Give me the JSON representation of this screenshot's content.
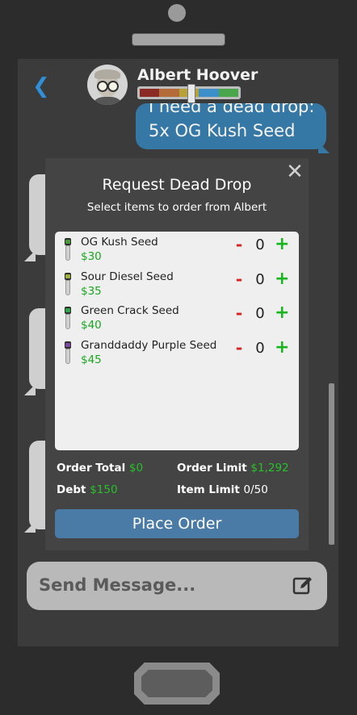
{
  "header": {
    "back_icon": "chevron-left-icon",
    "contact_name": "Albert Hoover",
    "relationship_colors": [
      "#8b2a24",
      "#b56a3a",
      "#b7a23a",
      "#3c8fc9",
      "#4aa64a"
    ],
    "relationship_level": 0.52
  },
  "messages": {
    "outgoing_lines": [
      "I need a dead drop:",
      "5x OG Kush Seed"
    ]
  },
  "dialog": {
    "title": "Request Dead Drop",
    "subtitle": "Select items to order from Albert",
    "close_icon": "close-icon",
    "items": [
      {
        "name": "OG Kush Seed",
        "price": "$30",
        "qty": "0",
        "minus": "-",
        "plus": "+",
        "leaf_color": "#4a9a3c"
      },
      {
        "name": "Sour Diesel Seed",
        "price": "$35",
        "qty": "0",
        "minus": "-",
        "plus": "+",
        "leaf_color": "#9fb33a"
      },
      {
        "name": "Green Crack Seed",
        "price": "$40",
        "qty": "0",
        "minus": "-",
        "plus": "+",
        "leaf_color": "#2fa84a"
      },
      {
        "name": "Granddaddy Purple Seed",
        "price": "$45",
        "qty": "0",
        "minus": "-",
        "plus": "+",
        "leaf_color": "#7b4aa0"
      }
    ],
    "order_total_label": "Order Total",
    "order_total_value": "$0",
    "order_limit_label": "Order Limit",
    "order_limit_value": "$1,292",
    "debt_label": "Debt",
    "debt_value": "$150",
    "item_limit_label": "Item Limit",
    "item_limit_value": "0/50",
    "place_order_label": "Place Order"
  },
  "composer": {
    "placeholder": "Send Message...",
    "edit_icon": "edit-icon"
  }
}
